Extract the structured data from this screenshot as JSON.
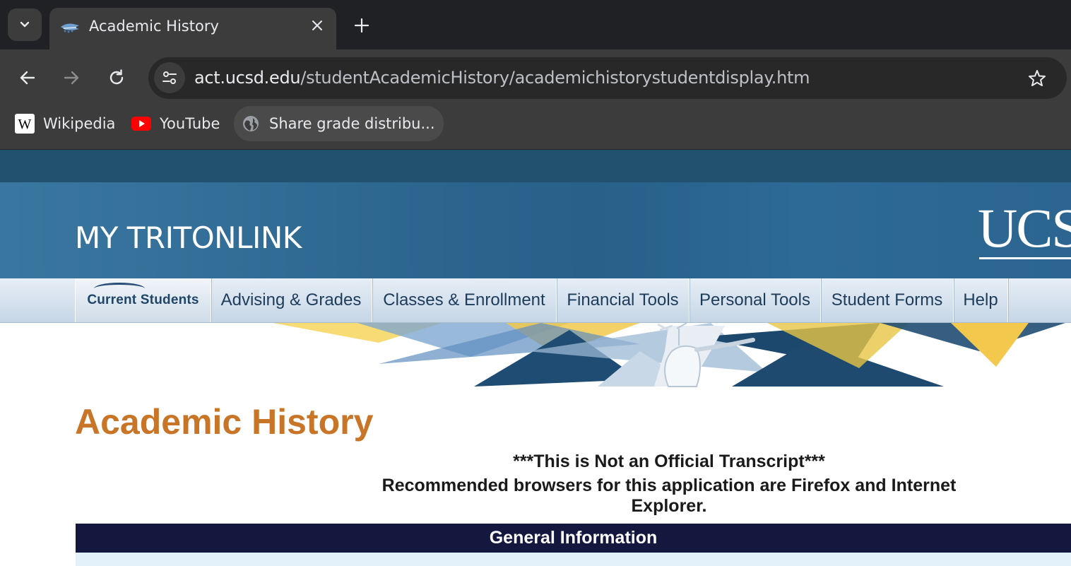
{
  "browser": {
    "tab": {
      "title": "Academic History"
    },
    "address_bar": {
      "url_host": "act.ucsd.edu",
      "url_path": "/studentAcademicHistory/academichistorystudentdisplay.htm"
    },
    "bookmarks": [
      {
        "label": "Wikipedia",
        "icon": "wikipedia-icon"
      },
      {
        "label": "YouTube",
        "icon": "youtube-icon"
      },
      {
        "label": "Share grade distribu...",
        "icon": "globe-icon"
      }
    ]
  },
  "site": {
    "title": "MY TRITONLINK",
    "logo_text": "UCS",
    "nav": [
      {
        "label": "Current Students"
      },
      {
        "label": "Advising & Grades"
      },
      {
        "label": "Classes & Enrollment"
      },
      {
        "label": "Financial Tools"
      },
      {
        "label": "Personal Tools"
      },
      {
        "label": "Student Forms"
      },
      {
        "label": "Help"
      }
    ]
  },
  "main": {
    "page_title": "Academic History",
    "notice_line1": "***This is Not an Official Transcript***",
    "notice_line2": "Recommended browsers for this application are Firefox and Internet Explorer.",
    "section_header": "General Information"
  },
  "colors": {
    "title_orange": "#c87528",
    "banner_blue": "#2f6a93",
    "section_header_navy": "#14183f",
    "chrome_dark": "#202124"
  }
}
